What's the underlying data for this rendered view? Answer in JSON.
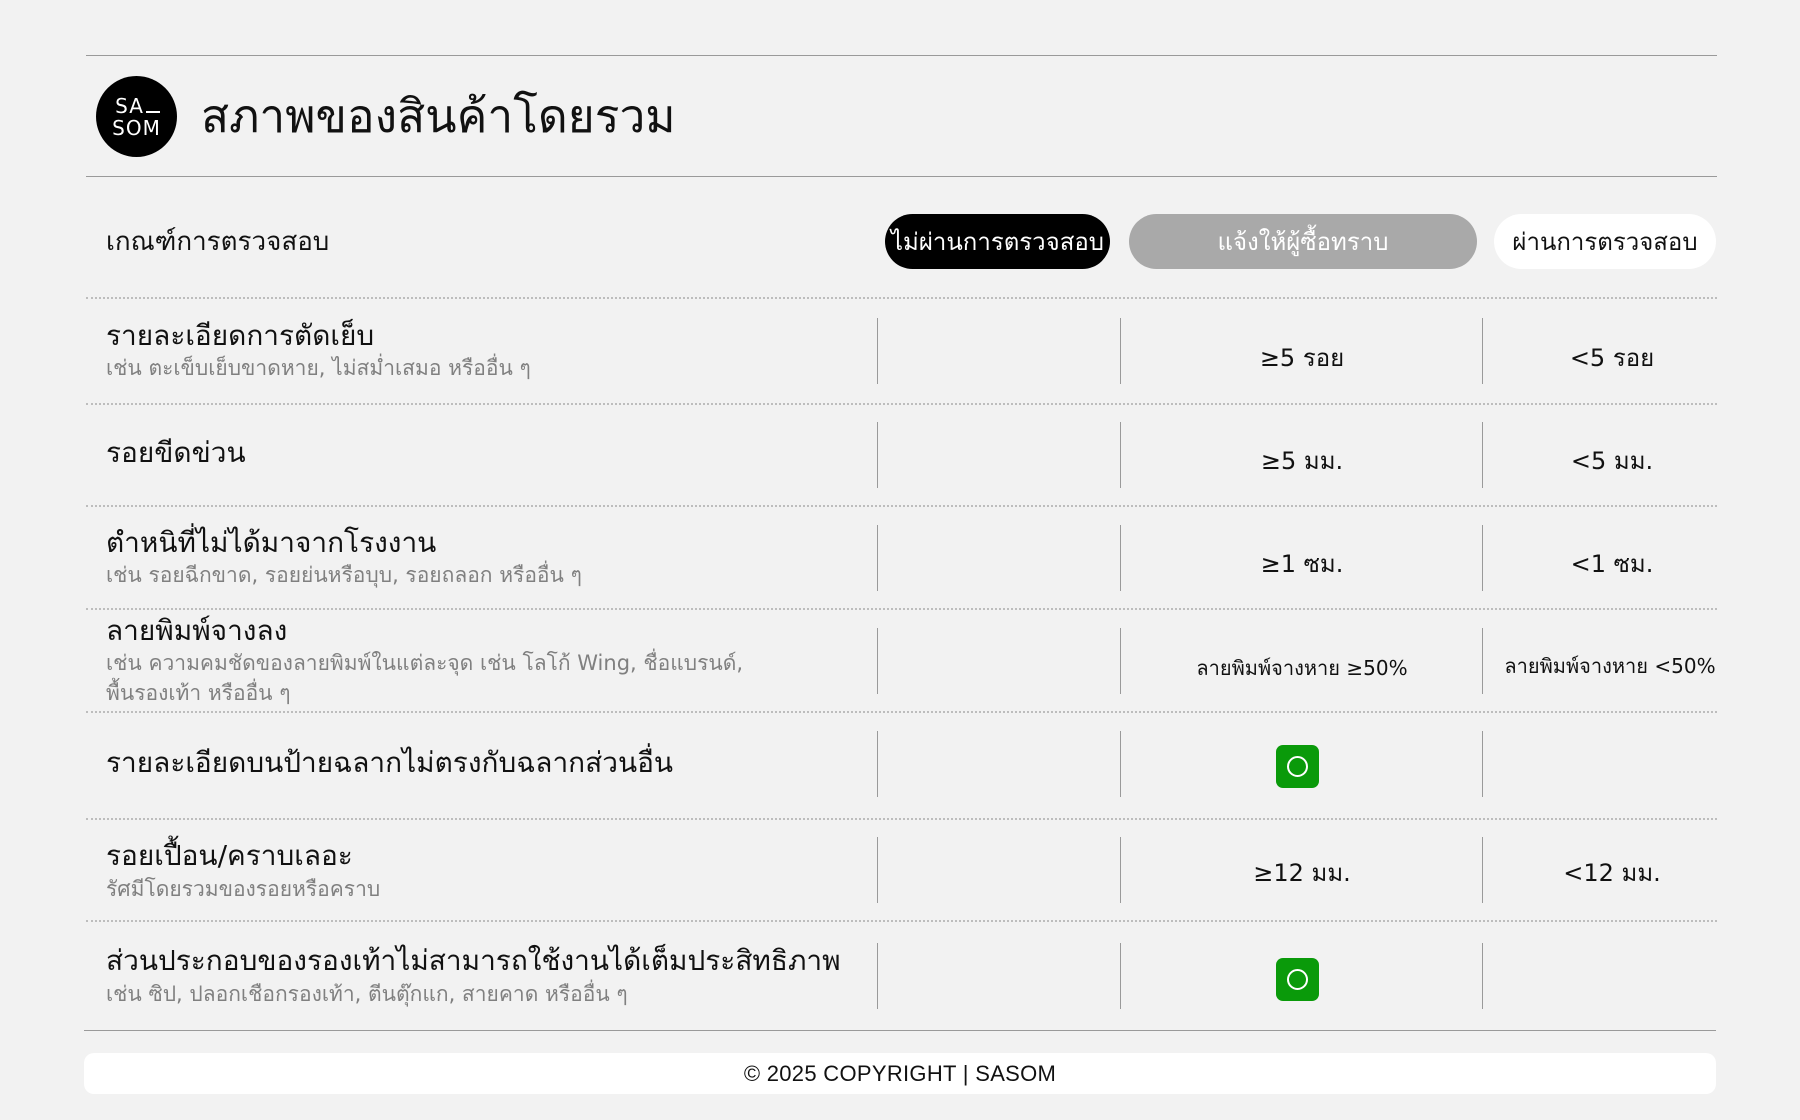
{
  "header": {
    "logo_line1": "SA",
    "logo_line2": "SOM",
    "title": "สภาพของสินค้าโดยรวม"
  },
  "table": {
    "criteria_header": "เกณฑ์การตรวจสอบ",
    "columns": {
      "fail": "ไม่ผ่านการตรวจสอบ",
      "notify": "แจ้งให้ผู้ซื้อทราบ",
      "pass": "ผ่านการตรวจสอบ"
    },
    "rows": [
      {
        "label": "รายละเอียดการตัดเย็บ",
        "sub": "เช่น ตะเข็บเย็บขาดหาย, ไม่สม่ำเสมอ หรืออื่น ๆ",
        "notify": "≥5 รอย",
        "pass": "<5 รอย"
      },
      {
        "label": "รอยขีดข่วน",
        "sub": "",
        "notify": "≥5 มม.",
        "pass": "<5 มม."
      },
      {
        "label": "ตำหนิที่ไม่ได้มาจากโรงงาน",
        "sub": "เช่น รอยฉีกขาด, รอยย่นหรือบุบ, รอยถลอก หรืออื่น ๆ",
        "notify": "≥1 ซม.",
        "pass": "<1 ซม."
      },
      {
        "label": "ลายพิมพ์จางลง",
        "sub": "เช่น ความคมชัดของลายพิมพ์ในแต่ละจุด เช่น โลโก้ Wing, ชื่อแบรนด์, พื้นรองเท้า หรืออื่น ๆ",
        "notify": "ลายพิมพ์จางหาย ≥50%",
        "pass": "ลายพิมพ์จางหาย <50%"
      },
      {
        "label": "รายละเอียดบนป้ายฉลากไม่ตรงกับฉลากส่วนอื่น",
        "sub": "",
        "notify_check": "check-icon",
        "pass": ""
      },
      {
        "label": "รอยเปื้อน/คราบเลอะ",
        "sub": "รัศมีโดยรวมของรอยหรือคราบ",
        "notify": "≥12 มม.",
        "pass": "<12 มม."
      },
      {
        "label": "ส่วนประกอบของรองเท้าไม่สามารถใช้งานได้เต็มประสิทธิภาพ",
        "sub": "เช่น ซิป, ปลอกเชือกรองเท้า, ตีนตุ๊กแก, สายคาด หรืออื่น ๆ",
        "notify_check": "check-icon",
        "pass": ""
      }
    ]
  },
  "footer": {
    "text": "© 2025 COPYRIGHT | SASOM"
  },
  "colors": {
    "background": "#f2f2f2",
    "fail_pill": "#000000",
    "notify_pill": "#a9a9a9",
    "pass_pill": "#ffffff",
    "check_green": "#0a9a0a"
  }
}
